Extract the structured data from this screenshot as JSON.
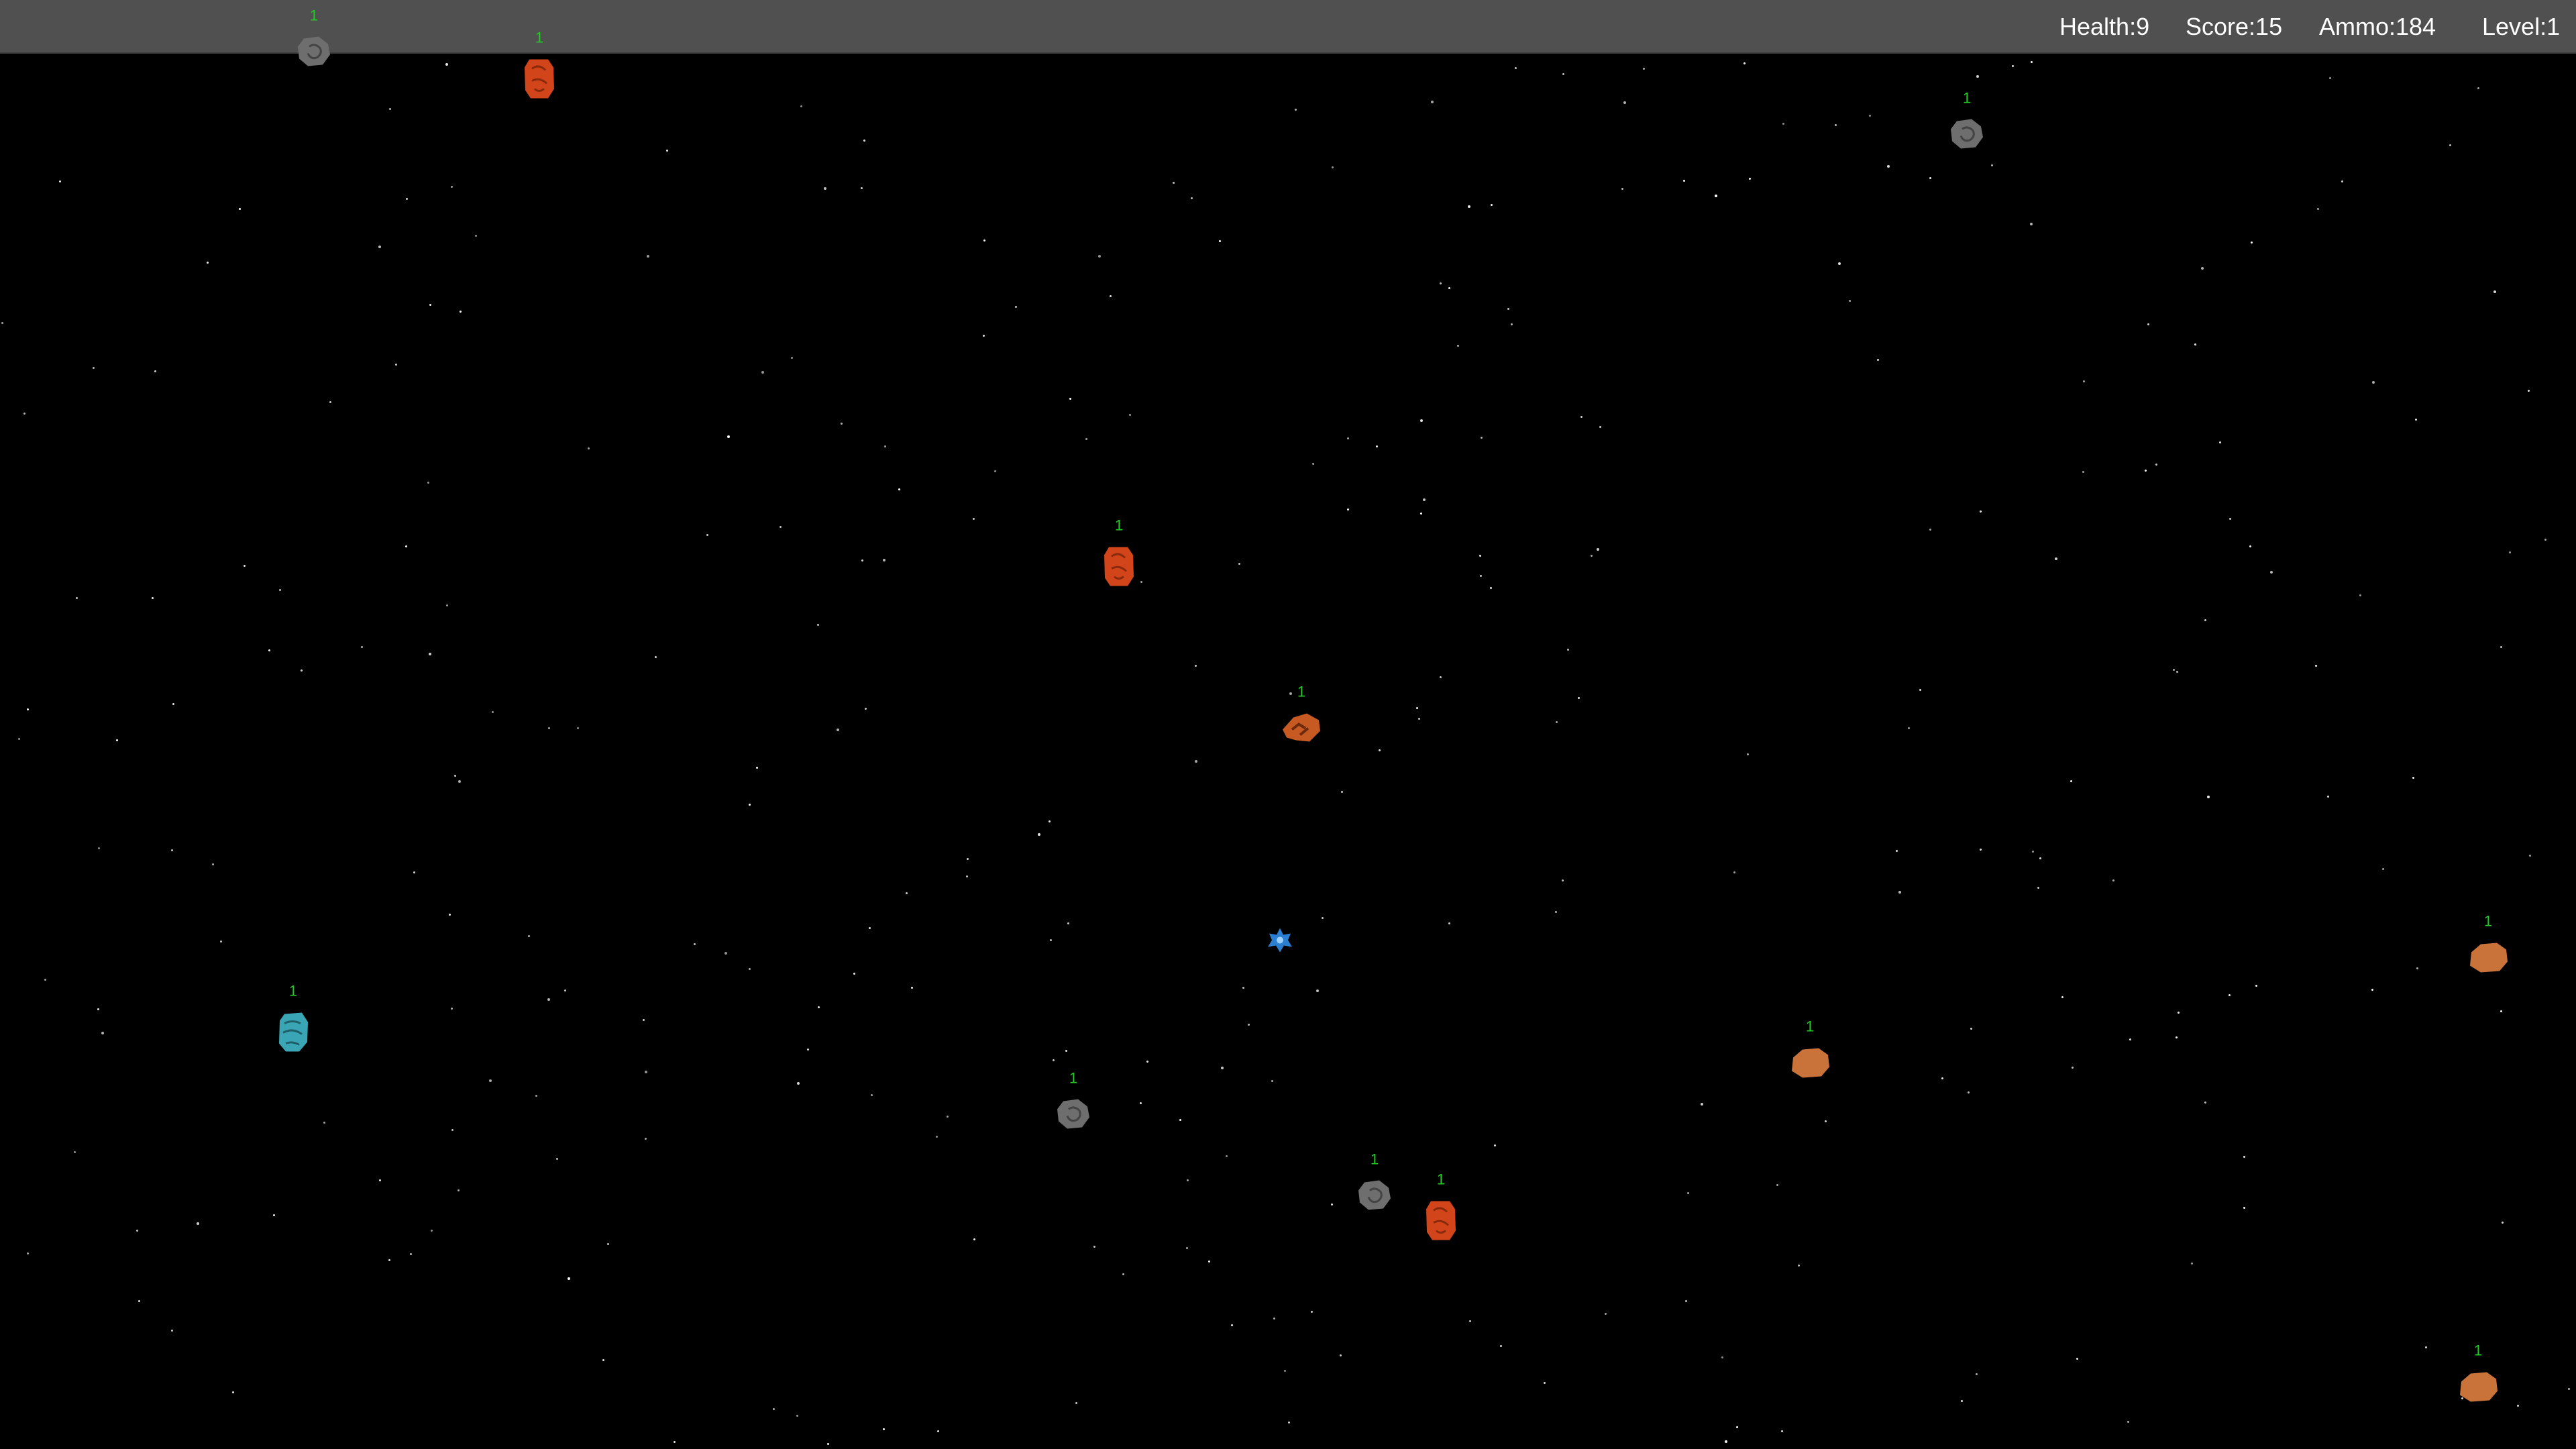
{
  "hud": {
    "health": "Health:9",
    "score": "Score:15",
    "ammo": "Ammo:184",
    "level": "Level:1"
  },
  "asteroids": [
    {
      "id": "a1",
      "hp_label": "1",
      "color": "#6e6e6e"
    },
    {
      "id": "a2",
      "hp_label": "1",
      "color": "#d2441a"
    },
    {
      "id": "a3",
      "hp_label": "1",
      "color": "#6e6e6e"
    },
    {
      "id": "a4",
      "hp_label": "1",
      "color": "#d2441a"
    },
    {
      "id": "a5",
      "hp_label": "1",
      "color": "#c65a22"
    },
    {
      "id": "a6",
      "hp_label": "1",
      "color": "#3aa5b5"
    },
    {
      "id": "a7",
      "hp_label": "1",
      "color": "#6e6e6e"
    },
    {
      "id": "a8",
      "hp_label": "1",
      "color": "#6e6e6e"
    },
    {
      "id": "a9",
      "hp_label": "1",
      "color": "#d2441a"
    },
    {
      "id": "a10",
      "hp_label": "1",
      "color": "#c9733a"
    },
    {
      "id": "a11",
      "hp_label": "1",
      "color": "#c9733a"
    },
    {
      "id": "a12",
      "hp_label": "1",
      "color": "#c9733a"
    }
  ],
  "player": {
    "color": "#2a7fd0",
    "icon": "spaceship-icon"
  }
}
